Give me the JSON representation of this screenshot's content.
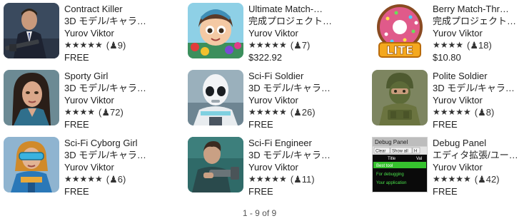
{
  "cards": [
    {
      "title": "Contract Killer",
      "category": "3D モデル/キャラ…",
      "author": "Yurov Viktor",
      "stars": "★★★★★",
      "rating_count": "(♟9)",
      "price": "FREE",
      "thumbnail_icon": "contract-killer-thumbnail"
    },
    {
      "title": "Ultimate Match-…",
      "category": "完成プロジェクト…",
      "author": "Yurov Viktor",
      "stars": "★★★★★",
      "rating_count": "(♟7)",
      "price": "$322.92",
      "thumbnail_icon": "ultimate-match-thumbnail"
    },
    {
      "title": "Berry Match-Thr…",
      "category": "完成プロジェクト…",
      "author": "Yurov Viktor",
      "stars": "★★★★",
      "rating_count": "(♟18)",
      "price": "$10.80",
      "thumbnail_icon": "berry-match-lite-thumbnail",
      "thumbnail_text": "LITE"
    },
    {
      "title": "Sporty Girl",
      "category": "3D モデル/キャラ…",
      "author": "Yurov Viktor",
      "stars": "★★★★",
      "rating_count": "(♟72)",
      "price": "FREE",
      "thumbnail_icon": "sporty-girl-thumbnail"
    },
    {
      "title": "Sci-Fi Soldier",
      "category": "3D モデル/キャラ…",
      "author": "Yurov Viktor",
      "stars": "★★★★★",
      "rating_count": "(♟26)",
      "price": "FREE",
      "thumbnail_icon": "sci-fi-soldier-thumbnail"
    },
    {
      "title": "Polite Soldier",
      "category": "3D モデル/キャラ…",
      "author": "Yurov Viktor",
      "stars": "★★★★★",
      "rating_count": "(♟8)",
      "price": "FREE",
      "thumbnail_icon": "polite-soldier-thumbnail"
    },
    {
      "title": "Sci-Fi Cyborg Girl",
      "category": "3D モデル/キャラ…",
      "author": "Yurov Viktor",
      "stars": "★★★★★",
      "rating_count": "(♟6)",
      "price": "FREE",
      "thumbnail_icon": "sci-fi-cyborg-girl-thumbnail"
    },
    {
      "title": "Sci-Fi Engineer",
      "category": "3D モデル/キャラ…",
      "author": "Yurov Viktor",
      "stars": "★★★★★",
      "rating_count": "(♟11)",
      "price": "FREE",
      "thumbnail_icon": "sci-fi-engineer-thumbnail"
    },
    {
      "title": "Debug Panel",
      "category": "エディタ拡張/ユー…",
      "author": "Yurov Viktor",
      "stars": "★★★★★",
      "rating_count": "(♟42)",
      "price": "FREE",
      "thumbnail_icon": "debug-panel-thumbnail",
      "thumbnail_ui": {
        "header": "Debug Panel",
        "tabs": [
          "Clear",
          "Show all",
          "H"
        ],
        "columns": [
          "Title",
          "Val"
        ],
        "rows": [
          "Best tool",
          "For debugging",
          "Your application"
        ]
      }
    }
  ],
  "pagination": "1 - 9 of 9"
}
